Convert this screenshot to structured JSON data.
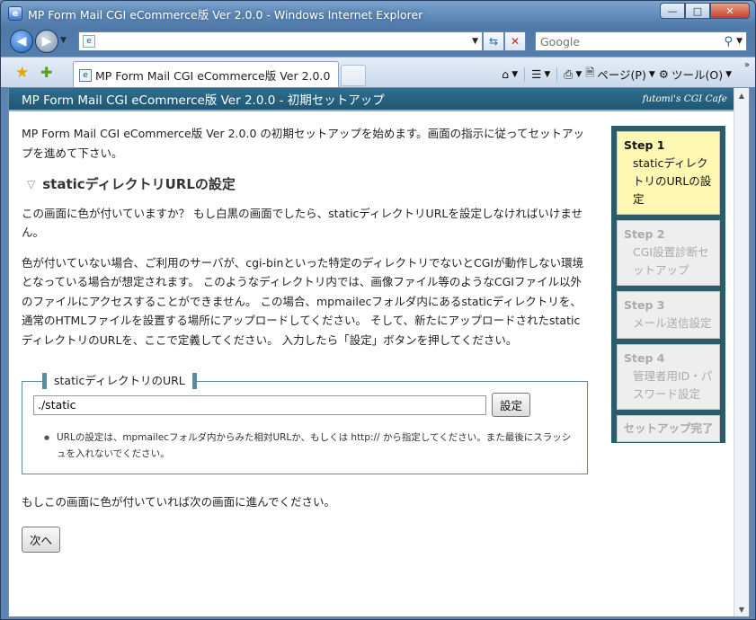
{
  "window": {
    "title": "MP Form Mail CGI eCommerce版 Ver 2.0.0 - Windows Internet Explorer",
    "minimize": "—",
    "maximize": "□",
    "close": "✕"
  },
  "browser": {
    "address_value": "",
    "search_placeholder": "Google",
    "tab_title": "MP Form Mail CGI eCommerce版 Ver 2.0.0",
    "cmd": {
      "page": "ページ(P)",
      "tools": "ツール(O)"
    }
  },
  "page": {
    "header_title": "MP Form Mail CGI eCommerce版 Ver 2.0.0 - 初期セットアップ",
    "brand": "futomi's CGI Cafe",
    "intro": "MP Form Mail CGI eCommerce版 Ver 2.0.0 の初期セットアップを始めます。画面の指示に従ってセットアップを進めて下さい。",
    "section_title": "staticディレクトリURLの設定",
    "para1": "この画面に色が付いていますか？ もし白黒の画面でしたら、staticディレクトリURLを設定しなければいけません。",
    "para2": "色が付いていない場合、ご利用のサーバが、cgi-binといった特定のディレクトリでないとCGIが動作しない環境となっている場合が想定されます。 このようなディレクトリ内では、画像ファイル等のようなCGIファイル以外のファイルにアクセスすることができません。 この場合、mpmailecフォルダ内にあるstaticディレクトリを、通常のHTMLファイルを設置する場所にアップロードしてください。 そして、新たにアップロードされたstaticディレクトリのURLを、ここで定義してください。 入力したら「設定」ボタンを押してください。",
    "fieldset_legend": "staticディレクトリのURL",
    "url_value": "./static",
    "set_button": "設定",
    "note": "URLの設定は、mpmailecフォルダ内からみた相対URLか、もしくは http:// から指定してください。また最後にスラッシュを入れないでください。",
    "after_text": "もしこの画面に色が付いていれば次の画面に進んでください。",
    "next_button": "次へ"
  },
  "steps": [
    {
      "num": "Step 1",
      "label": "staticディレクトリのURLの設定"
    },
    {
      "num": "Step 2",
      "label": "CGI設置診断セットアップ"
    },
    {
      "num": "Step 3",
      "label": "メール送信設定"
    },
    {
      "num": "Step 4",
      "label": "管理者用ID・パスワード設定"
    }
  ],
  "steps_complete": "セットアップ完了"
}
